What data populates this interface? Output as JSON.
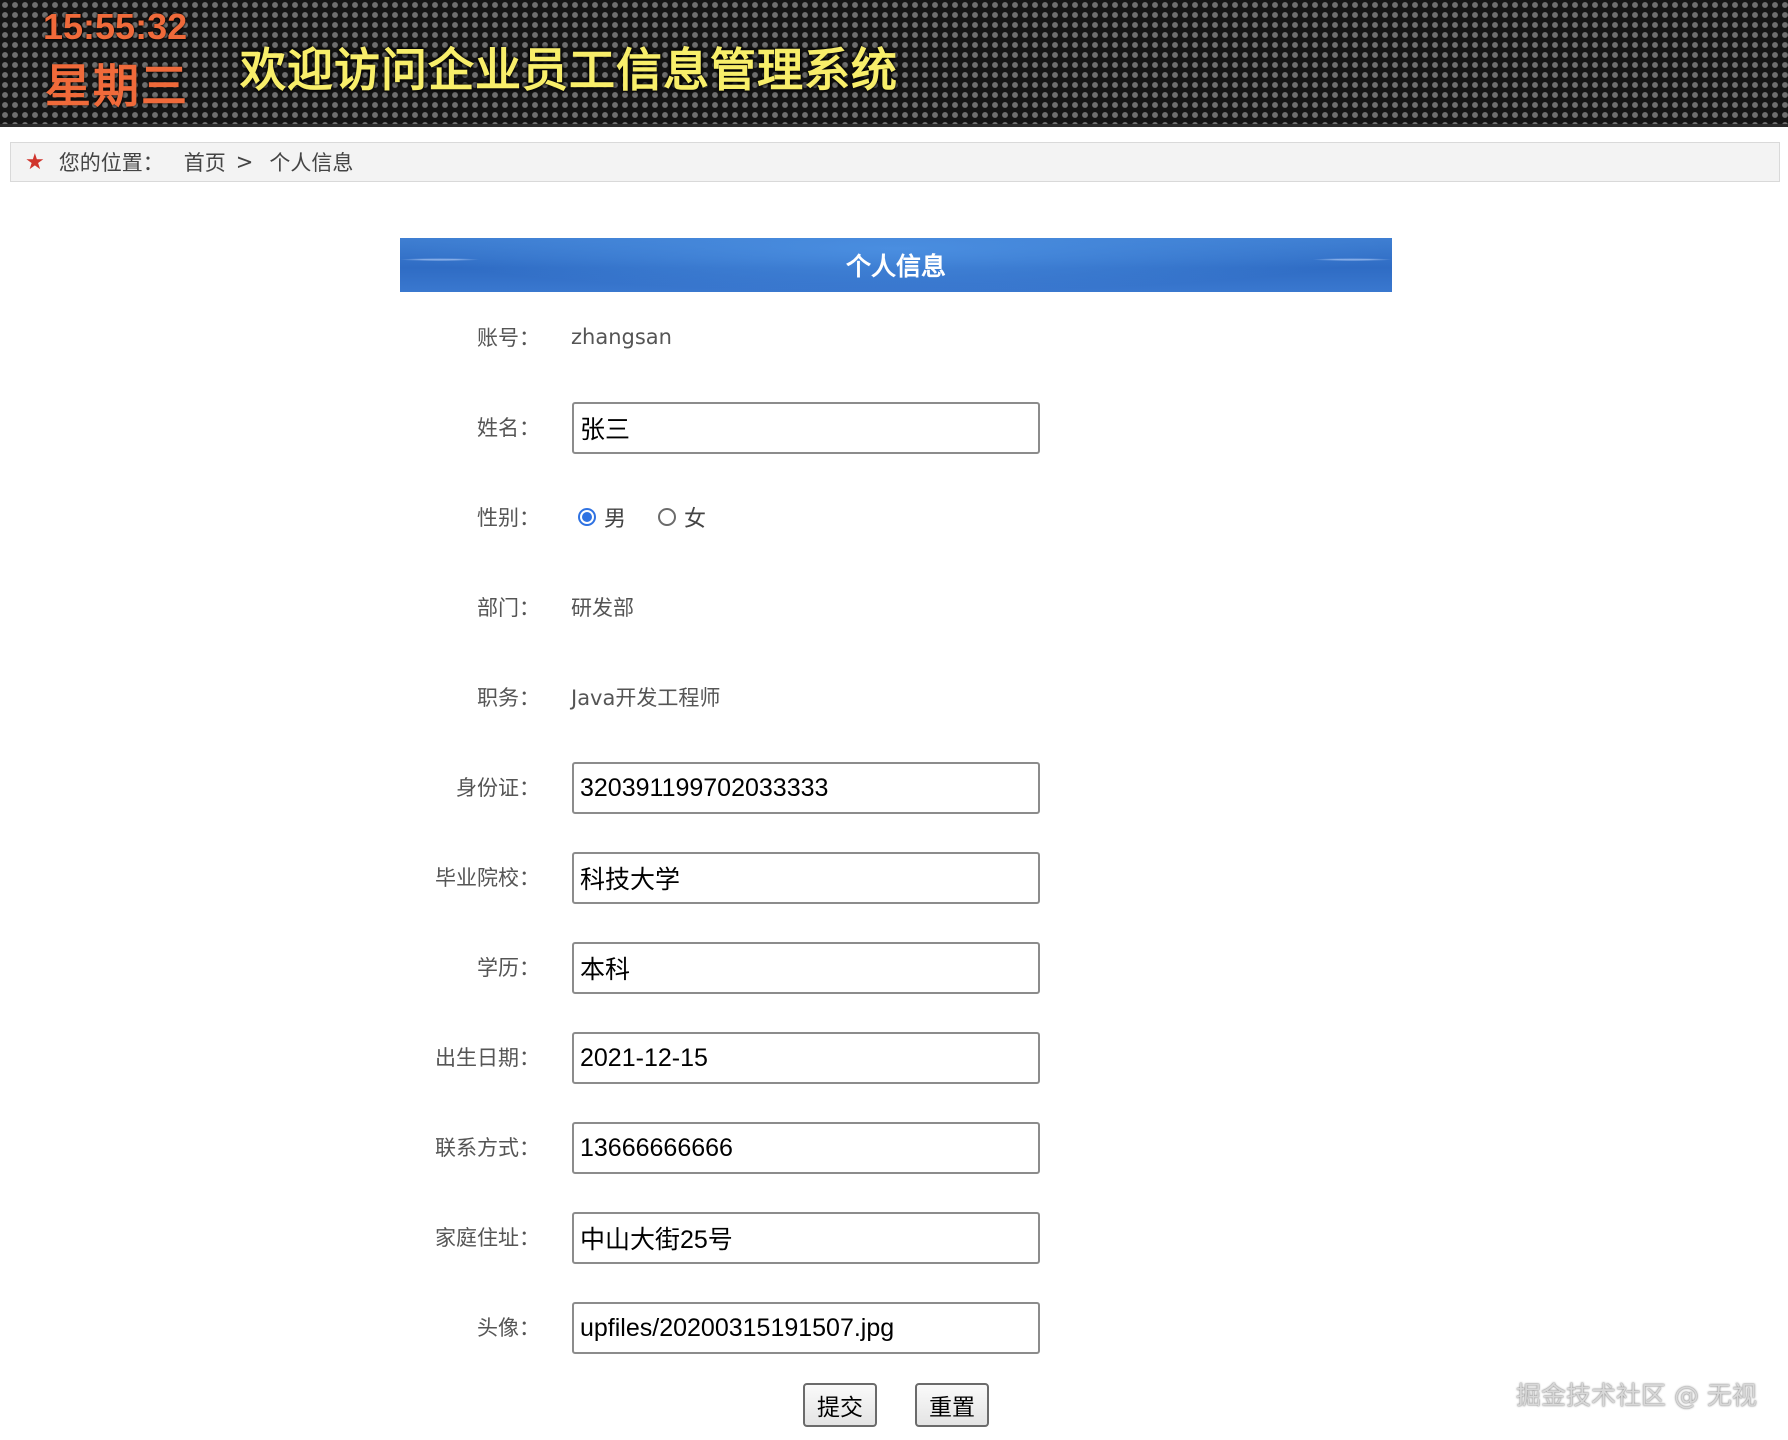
{
  "header": {
    "time": "15:55:32",
    "weekday": "星期三",
    "title": "欢迎访问企业员工信息管理系统"
  },
  "breadcrumb": {
    "prefix": "您的位置：",
    "home": "首页",
    "separator": ">",
    "current": "个人信息"
  },
  "panel": {
    "title": "个人信息"
  },
  "form": {
    "account": {
      "label": "账号：",
      "value": "zhangsan"
    },
    "name": {
      "label": "姓名：",
      "value": "张三"
    },
    "gender": {
      "label": "性别：",
      "options": [
        "男",
        "女"
      ],
      "selected": "男"
    },
    "department": {
      "label": "部门：",
      "value": "研发部"
    },
    "position": {
      "label": "职务：",
      "value": "Java开发工程师"
    },
    "id_card": {
      "label": "身份证：",
      "value": "320391199702033333"
    },
    "school": {
      "label": "毕业院校：",
      "value": "科技大学"
    },
    "education": {
      "label": "学历：",
      "value": "本科"
    },
    "birthday": {
      "label": "出生日期：",
      "value": "2021-12-15"
    },
    "contact": {
      "label": "联系方式：",
      "value": "13666666666"
    },
    "address": {
      "label": "家庭住址：",
      "value": "中山大街25号"
    },
    "avatar": {
      "label": "头像：",
      "value": "upfiles/20200315191507.jpg"
    }
  },
  "buttons": {
    "submit": "提交",
    "reset": "重置"
  },
  "watermark": "掘金技术社区 @ 无视",
  "colors": {
    "clock": "#f06a3a",
    "title": "#f8ee6a",
    "panel_header": "#2f6cc4",
    "radio_accent": "#2f72e2",
    "breadcrumb_star": "#d0342c"
  }
}
